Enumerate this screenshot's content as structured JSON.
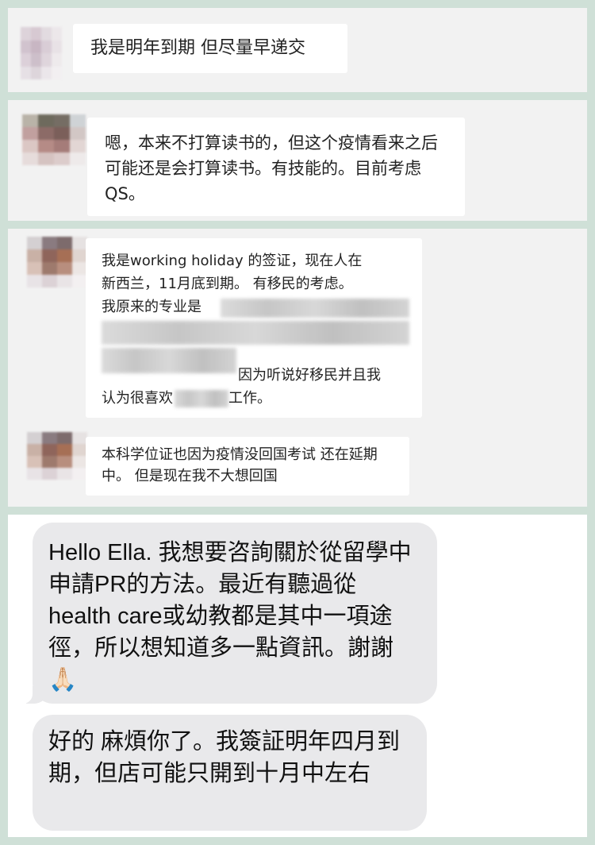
{
  "wechat": {
    "msg1": "我是明年到期 但尽量早递交",
    "msg2": "嗯，本来不打算读书的，但这个疫情看来之后可能还是会打算读书。有技能的。目前考虑QS。",
    "msg3_line1": "我是working holiday 的签证，现在人在",
    "msg3_line2": "新西兰，11月底到期。 有移民的考虑。",
    "msg3_line3": "我原来的专业是",
    "msg3_line5": "因为听说好移民并且我",
    "msg3_line6a": "认为很喜欢",
    "msg3_line6b": "工作。",
    "msg4": "本科学位证也因为疫情没回国考试 还在延期中。 但是现在我不大想回国"
  },
  "imessage": {
    "msg1": "Hello Ella. 我想要咨詢關於從留學中申請PR的方法。最近有聽過從 health care或幼教都是其中一項途徑，所以想知道多一點資訊。謝謝🙏🏻",
    "msg2": "好的 麻煩你了。我簽証明年四月到期，但店可能只開到十月中左右"
  },
  "colors": {
    "frame": "#cfe0d7",
    "panel": "#f2f2f2",
    "bubble": "#ffffff",
    "imessage_bubble": "#e9e9eb"
  }
}
